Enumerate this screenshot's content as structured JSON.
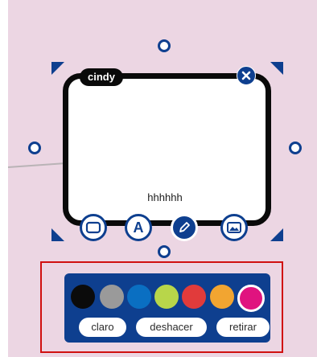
{
  "note": {
    "author": "cindy",
    "text": "hhhhhh"
  },
  "tools": [
    {
      "name": "shape-tool",
      "icon": "rectangle-icon"
    },
    {
      "name": "text-tool",
      "icon": "letter-a-icon",
      "glyph": "A"
    },
    {
      "name": "pen-tool",
      "icon": "pencil-icon",
      "active": true
    },
    {
      "name": "image-tool",
      "icon": "image-icon"
    }
  ],
  "palette": {
    "colors": [
      "#0b0b0b",
      "#9a9a9a",
      "#0a6fc2",
      "#b8d64a",
      "#e13b3b",
      "#f2a531",
      "#e0137f"
    ],
    "selected_index": 6,
    "actions": {
      "light": "claro",
      "undo": "deshacer",
      "remove": "retirar"
    }
  },
  "colors": {
    "background": "#ecd6e3",
    "accent": "#0e3f8f",
    "note_border": "#0a0a0a",
    "highlight": "#d01010"
  }
}
